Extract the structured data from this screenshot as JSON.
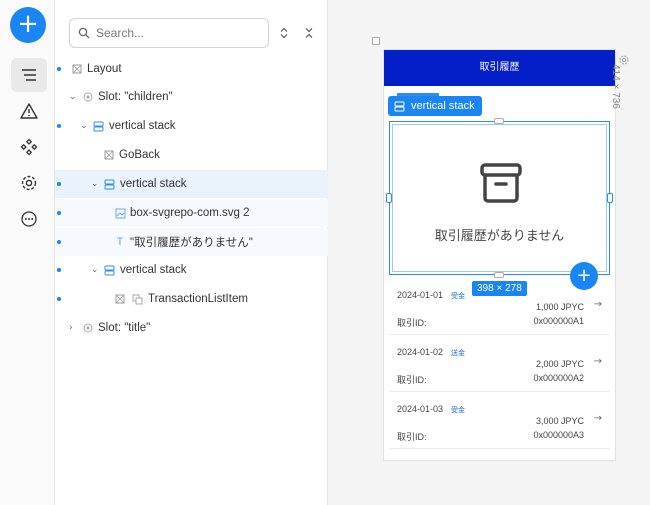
{
  "rail": {
    "add_glyph": "+",
    "icons": [
      "tree-icon",
      "warning-icon",
      "components-icon",
      "settings-icon",
      "more-icon"
    ]
  },
  "search": {
    "placeholder": "Search..."
  },
  "tree": {
    "layout_label": "Layout",
    "slot_children_label": "Slot: \"children\"",
    "vstack1_label": "vertical stack",
    "goback_label": "GoBack",
    "vstack2_label": "vertical stack",
    "svg_label": "box-svgrepo-com.svg 2",
    "text_label": "\"取引履歴がありません\"",
    "vstack3_label": "vertical stack",
    "txlist_label": "TransactionListItem",
    "slot_title_label": "Slot: \"title\""
  },
  "canvas": {
    "frame_size": "414 × 736",
    "selection_tag": "vertical stack",
    "selection_size": "398 × 278",
    "app_title": "取引履歴",
    "empty_message": "取引履歴がありません",
    "fab_glyph": "+",
    "transactions": [
      {
        "date": "2024-01-01",
        "type": "受金",
        "amount": "1,000 JPYC",
        "id_label": "取引ID:",
        "id": "0x000000A1"
      },
      {
        "date": "2024-01-02",
        "type": "送金",
        "amount": "2,000 JPYC",
        "id_label": "取引ID:",
        "id": "0x000000A2"
      },
      {
        "date": "2024-01-03",
        "type": "受金",
        "amount": "3,000 JPYC",
        "id_label": "取引ID:",
        "id": "0x000000A3"
      }
    ]
  },
  "colors": {
    "accent": "#1a86f5",
    "appbar": "#0320c8"
  }
}
